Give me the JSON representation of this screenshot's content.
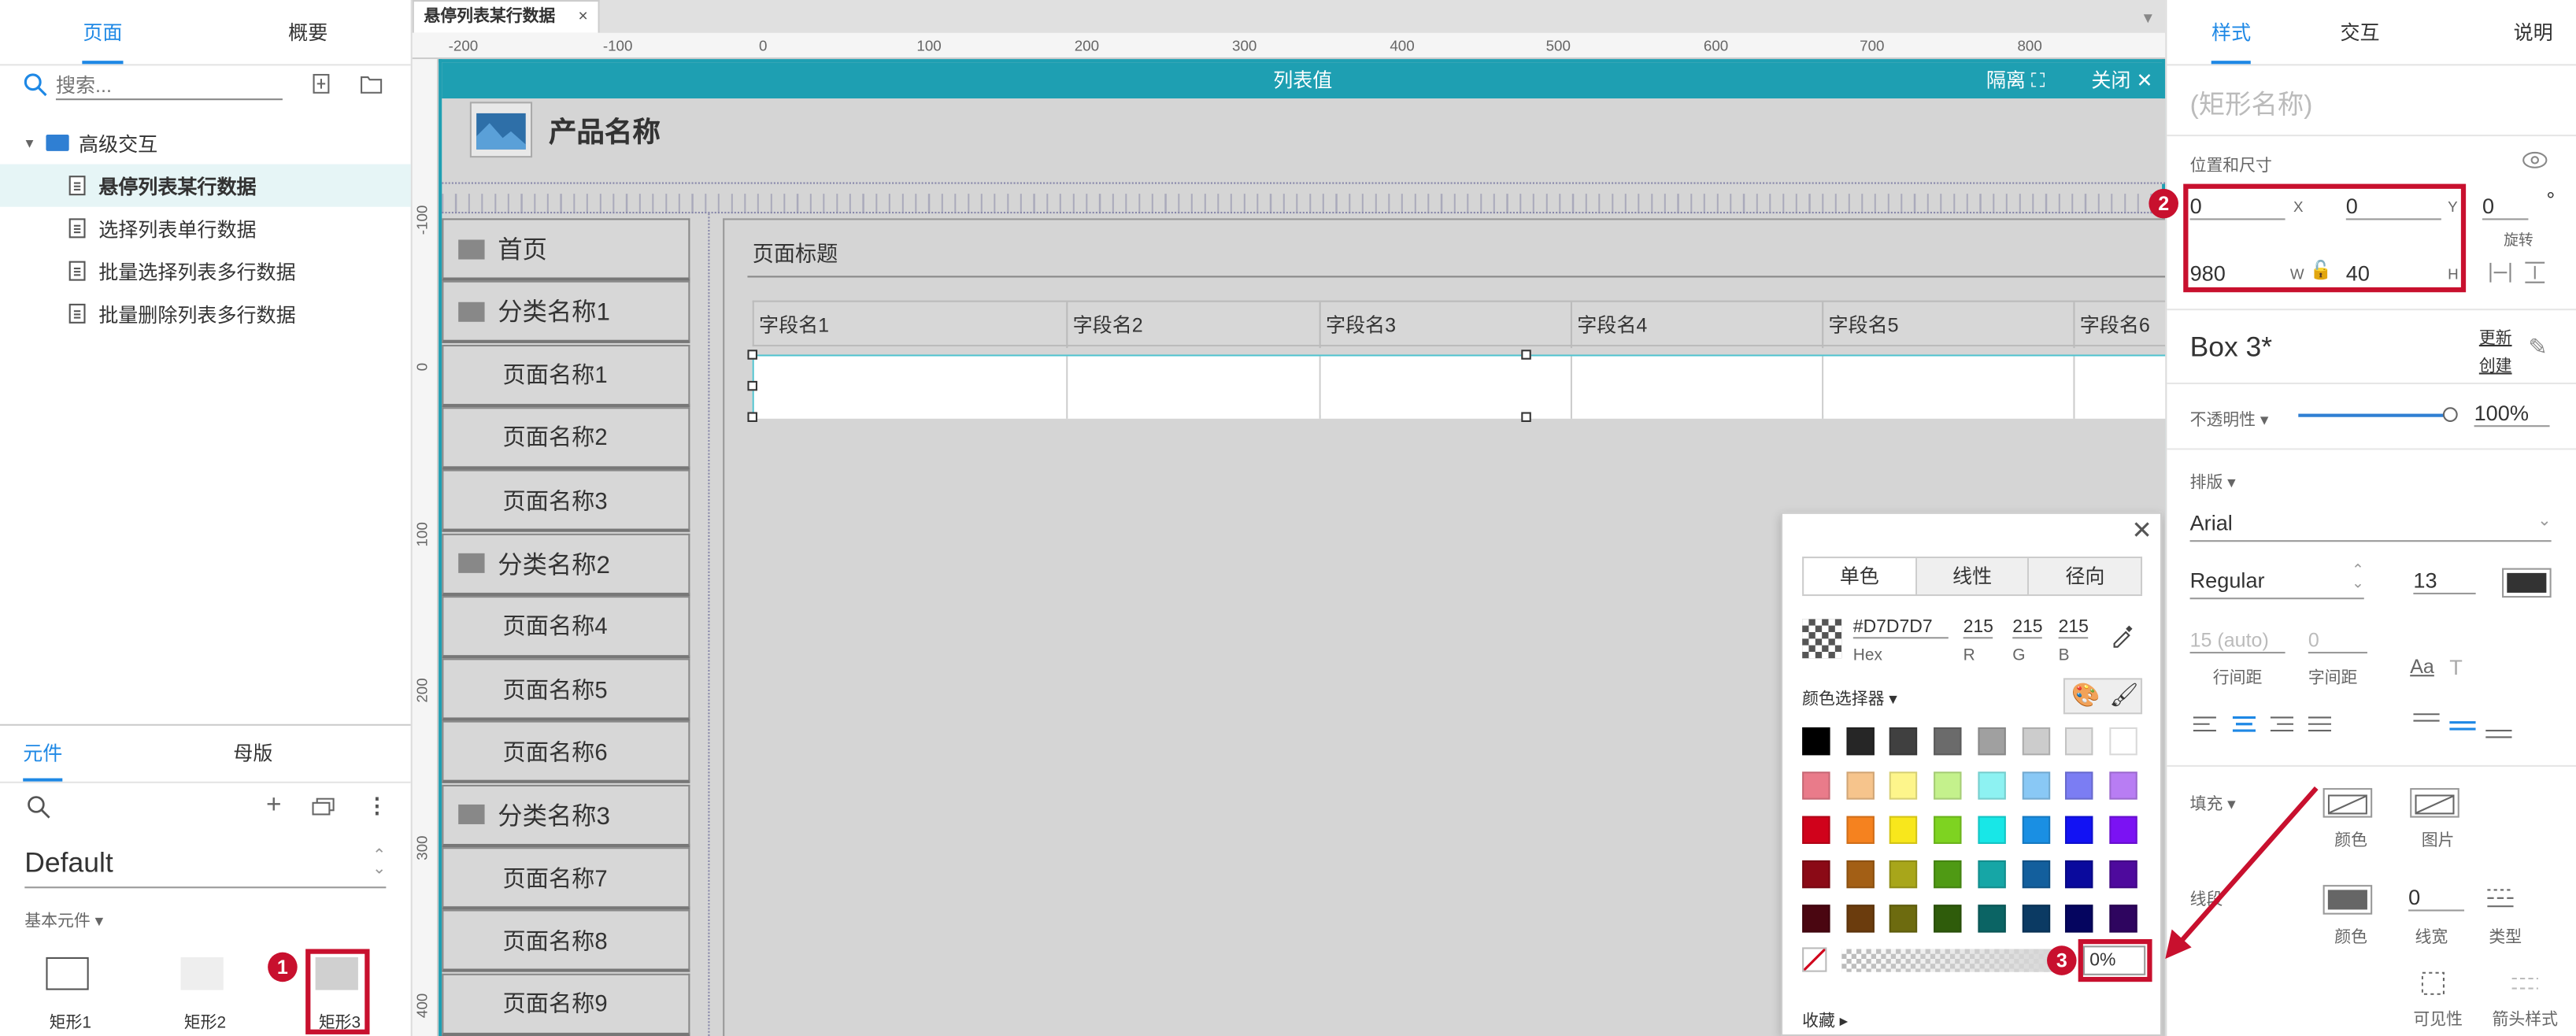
{
  "left_panel": {
    "tabs": [
      "页面",
      "概要"
    ],
    "search_placeholder": "搜索...",
    "folder": "高级交互",
    "pages": [
      "悬停列表某行数据",
      "选择列表单行数据",
      "批量选择列表多行数据",
      "批量删除列表多行数据"
    ],
    "bottom_tabs": [
      "元件",
      "母版"
    ],
    "library": "Default",
    "section": "基本元件",
    "widgets": [
      "矩形1",
      "矩形2",
      "矩形3"
    ]
  },
  "canvas": {
    "file_tab": "悬停列表某行数据",
    "ruler_h": [
      "-200",
      "-100",
      "0",
      "100",
      "200",
      "300",
      "400",
      "500",
      "600",
      "700",
      "800"
    ],
    "ruler_v": [
      "-100",
      "0",
      "100",
      "200",
      "300",
      "400"
    ],
    "dialog_title": "列表值",
    "btn_isolate": "隔离",
    "btn_close": "关闭",
    "product_name": "产品名称",
    "nav": [
      {
        "label": "首页",
        "cat": true
      },
      {
        "label": "分类名称1",
        "cat": true
      },
      {
        "label": "页面名称1",
        "cat": false
      },
      {
        "label": "页面名称2",
        "cat": false
      },
      {
        "label": "页面名称3",
        "cat": false
      },
      {
        "label": "分类名称2",
        "cat": true
      },
      {
        "label": "页面名称4",
        "cat": false
      },
      {
        "label": "页面名称5",
        "cat": false
      },
      {
        "label": "页面名称6",
        "cat": false
      },
      {
        "label": "分类名称3",
        "cat": true
      },
      {
        "label": "页面名称7",
        "cat": false
      },
      {
        "label": "页面名称8",
        "cat": false
      },
      {
        "label": "页面名称9",
        "cat": false
      }
    ],
    "page_title": "页面标题",
    "columns": [
      "字段名1",
      "字段名2",
      "字段名3",
      "字段名4",
      "字段名5",
      "字段名6"
    ]
  },
  "color_picker": {
    "tabs": [
      "单色",
      "线性",
      "径向"
    ],
    "hex": "#D7D7D7",
    "hex_label": "Hex",
    "r": "215",
    "g": "215",
    "b": "215",
    "r_label": "R",
    "g_label": "G",
    "b_label": "B",
    "selector_label": "颜色选择器",
    "opacity": "0%",
    "favorites": "收藏",
    "swatches": [
      [
        "#000000",
        "#262626",
        "#404040",
        "#6b6b6b",
        "#a0a0a0",
        "#cccccc",
        "#e6e6e6",
        "#ffffff"
      ],
      [
        "#e97b8a",
        "#f6c48c",
        "#fdf58b",
        "#c4f18c",
        "#8df2f2",
        "#89c8f5",
        "#7b7df3",
        "#b87df3"
      ],
      [
        "#d0021b",
        "#f5821f",
        "#f8e71c",
        "#7ed321",
        "#18e7e7",
        "#1a8fe3",
        "#1212f3",
        "#7b12f3"
      ],
      [
        "#8b0a16",
        "#a35f15",
        "#a8a61a",
        "#4f9a14",
        "#16a6a6",
        "#135f9d",
        "#0a0a9d",
        "#4e0a9d"
      ],
      [
        "#4a0611",
        "#6b3c0d",
        "#6d6b0f",
        "#2f5c0b",
        "#0b6464",
        "#0b3a63",
        "#05055f",
        "#2e055f"
      ]
    ]
  },
  "right_panel": {
    "tabs": [
      "样式",
      "交互",
      "说明"
    ],
    "name_placeholder": "(矩形名称)",
    "pos_size": "位置和尺寸",
    "x": "0",
    "y": "0",
    "w": "980",
    "h": "40",
    "rotation": "0",
    "deg": "°",
    "x_label": "X",
    "y_label": "Y",
    "w_label": "W",
    "h_label": "H",
    "rot_label": "旋转",
    "style_name": "Box 3*",
    "update": "更新",
    "create": "创建",
    "opacity_label": "不透明性",
    "opacity": "100%",
    "typography": "排版",
    "font": "Arial",
    "weight": "Regular",
    "size": "13",
    "line_height": "15 (auto)",
    "letter_spacing": "0",
    "lh_label": "行间距",
    "ls_label": "字间距",
    "fill": "填充",
    "color": "颜色",
    "image": "图片",
    "border": "线段",
    "border_width": "0",
    "width_label": "线宽",
    "type_label": "类型",
    "visibility": "可见性",
    "arrow": "箭头样式"
  },
  "annotations": {
    "b1": "1",
    "b2": "2",
    "b3": "3",
    "accent": "#c8102e"
  }
}
